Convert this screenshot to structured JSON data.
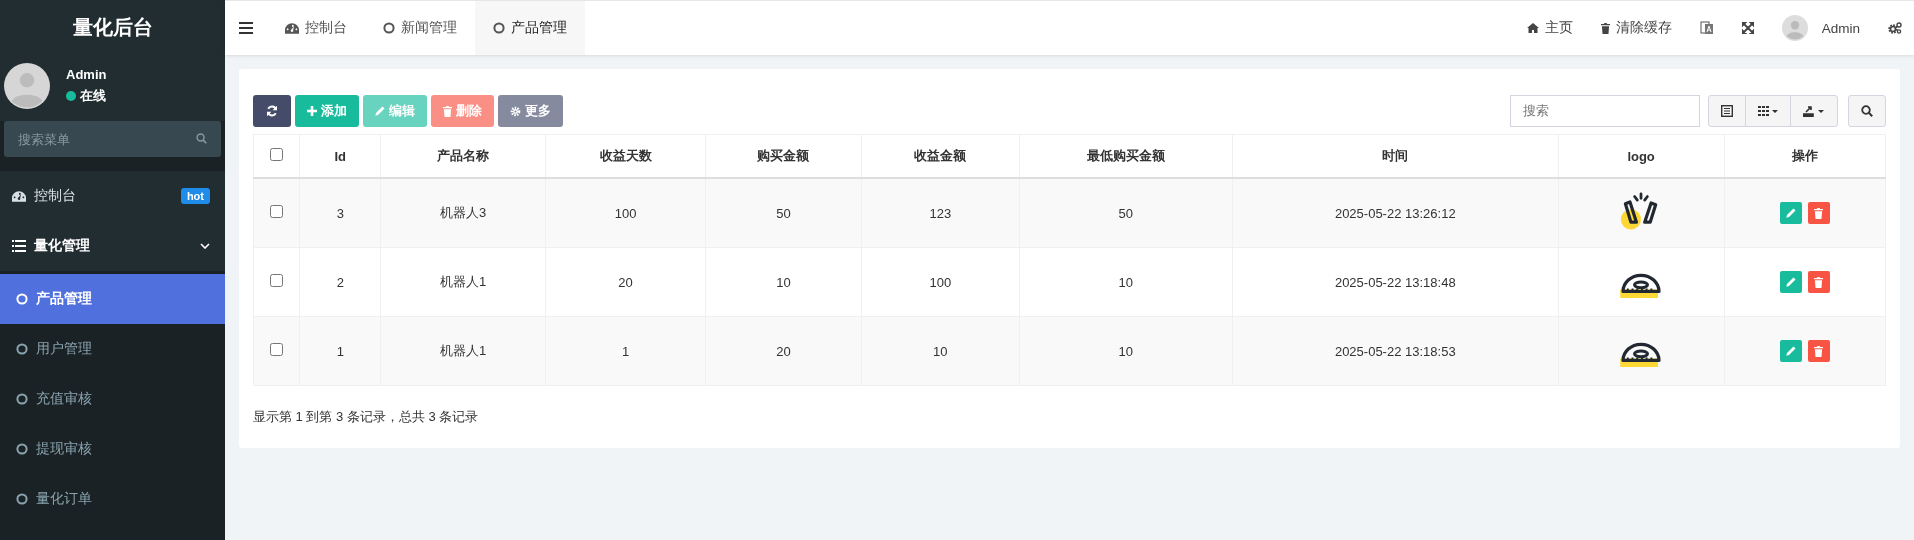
{
  "sidebar": {
    "brand": "量化后台",
    "user": {
      "name": "Admin",
      "status": "在线",
      "online": true
    },
    "search": {
      "placeholder": "搜索菜单"
    },
    "menu": [
      {
        "kind": "dashboard",
        "label": "控制台",
        "badge": "hot",
        "selected": false
      },
      {
        "kind": "group",
        "label": "量化管理",
        "expanded": true,
        "selected": false,
        "children": [
          {
            "label": "产品管理",
            "selected": true
          },
          {
            "label": "用户管理",
            "selected": false
          },
          {
            "label": "充值审核",
            "selected": false
          },
          {
            "label": "提现审核",
            "selected": false
          },
          {
            "label": "量化订单",
            "selected": false
          }
        ]
      }
    ]
  },
  "tabs": [
    {
      "kind": "dashboard",
      "label": "控制台",
      "selected": false
    },
    {
      "kind": "page",
      "label": "新闻管理",
      "selected": false
    },
    {
      "kind": "page",
      "label": "产品管理",
      "selected": true
    }
  ],
  "navbar": {
    "home": "主页",
    "clear_cache": "清除缓存",
    "user": "Admin"
  },
  "toolbar": {
    "buttons": [
      {
        "kind": "refresh"
      },
      {
        "kind": "add",
        "label": "添加",
        "disabled": false
      },
      {
        "kind": "edit",
        "label": "编辑",
        "disabled": true
      },
      {
        "kind": "delete",
        "label": "删除",
        "disabled": true
      },
      {
        "kind": "more",
        "label": "更多",
        "disabled": false
      }
    ],
    "search": {
      "placeholder": "搜索"
    }
  },
  "table": {
    "all_checked": false,
    "columns": [
      "Id",
      "产品名称",
      "收益天数",
      "购买金额",
      "收益金额",
      "最低购买金额",
      "时间",
      "logo",
      "操作"
    ],
    "rows": [
      {
        "checked": false,
        "cells": [
          "3",
          "机器人3",
          "100",
          "50",
          "123",
          "50",
          "2025-05-22 13:26:12"
        ],
        "logo": {
          "kind": "hands"
        }
      },
      {
        "checked": false,
        "cells": [
          "2",
          "机器人1",
          "20",
          "10",
          "100",
          "10",
          "2025-05-22 13:18:48"
        ],
        "logo": {
          "kind": "protractor"
        }
      },
      {
        "checked": false,
        "cells": [
          "1",
          "机器人1",
          "1",
          "20",
          "10",
          "10",
          "2025-05-22 13:18:53"
        ],
        "logo": {
          "kind": "protractor"
        }
      }
    ]
  },
  "pagination": {
    "summary": "显示第 1 到第 3 条记录，总共 3 条记录"
  }
}
